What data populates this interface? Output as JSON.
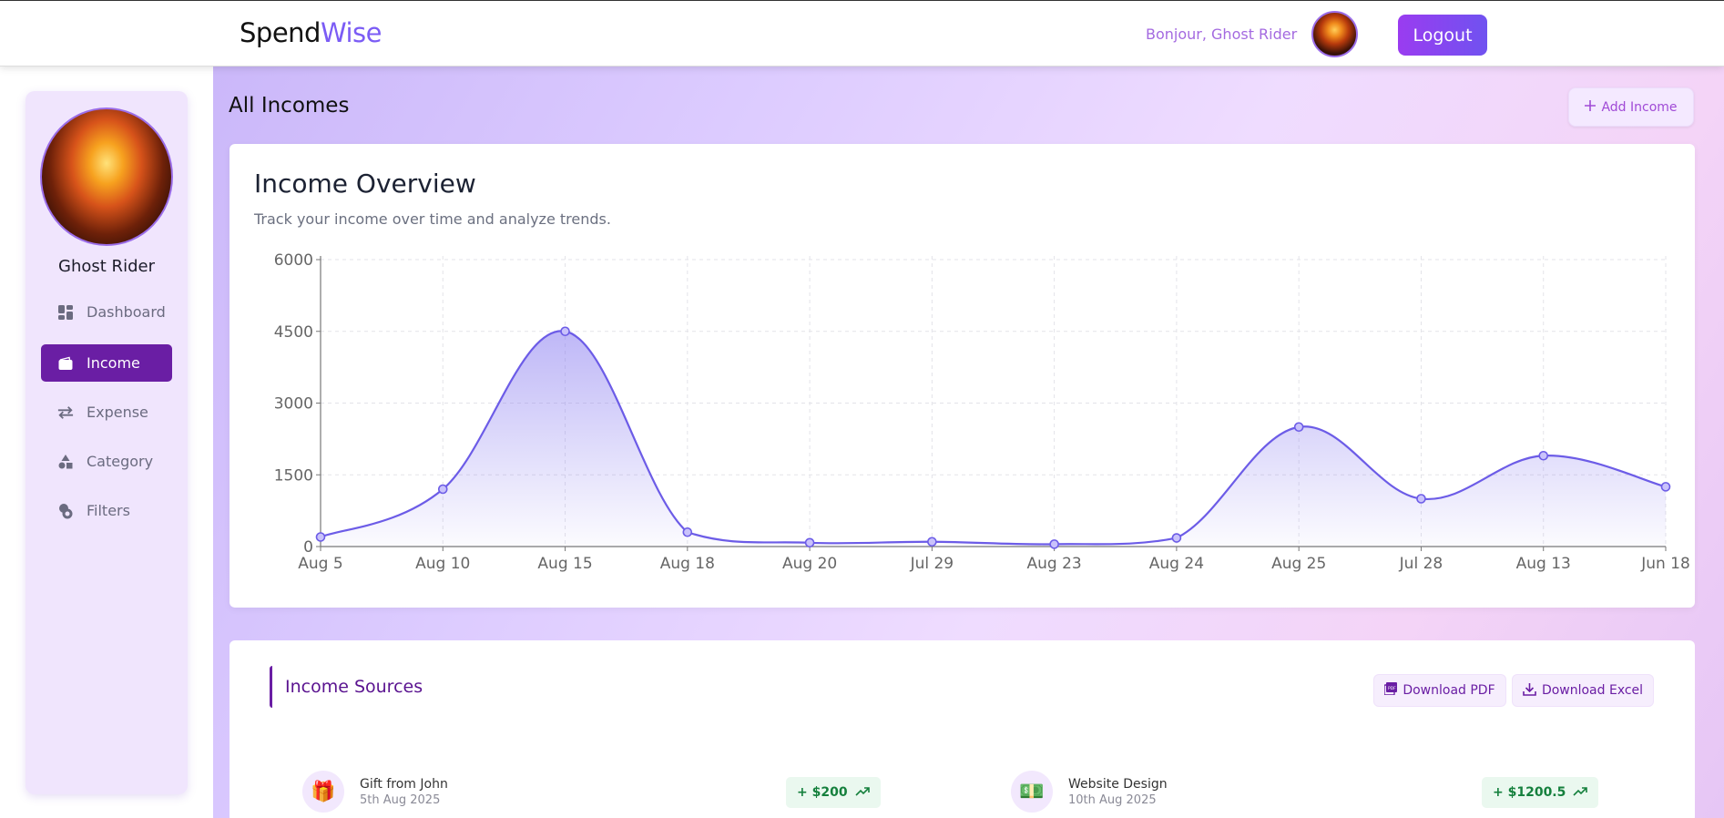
{
  "header": {
    "brand_part1": "Spend",
    "brand_part2": "Wise",
    "greeting": "Bonjour, Ghost Rider",
    "logout_label": "Logout"
  },
  "sidebar": {
    "user_name": "Ghost Rider",
    "items": [
      {
        "label": "Dashboard",
        "icon": "dashboard-icon",
        "active": false
      },
      {
        "label": "Income",
        "icon": "wallet-icon",
        "active": true
      },
      {
        "label": "Expense",
        "icon": "exchange-icon",
        "active": false
      },
      {
        "label": "Category",
        "icon": "shapes-icon",
        "active": false
      },
      {
        "label": "Filters",
        "icon": "filter-icon",
        "active": false
      }
    ]
  },
  "page": {
    "title": "All Incomes",
    "add_label": "Add Income"
  },
  "overview": {
    "title": "Income Overview",
    "subtitle": "Track your income over time and analyze trends."
  },
  "chart_data": {
    "type": "area",
    "categories": [
      "Aug 5",
      "Aug 10",
      "Aug 15",
      "Aug 18",
      "Aug 20",
      "Jul 29",
      "Aug 23",
      "Aug 24",
      "Aug 25",
      "Jul 28",
      "Aug 13",
      "Jun 18"
    ],
    "values": [
      200,
      1200,
      4500,
      300,
      80,
      100,
      50,
      180,
      2500,
      1000,
      1900,
      1250
    ],
    "yticks": [
      0,
      1500,
      3000,
      4500,
      6000
    ],
    "ylim": [
      0,
      6000
    ],
    "grid": true,
    "colors": {
      "line": "#6c5ce7",
      "fill_top": "#8a7df0",
      "grid": "#e3e3e8",
      "axis": "#777",
      "tick": "#666"
    }
  },
  "sources": {
    "title": "Income Sources",
    "download_pdf": "Download PDF",
    "download_excel": "Download Excel",
    "items": [
      {
        "name": "Gift from John",
        "date": "5th Aug 2025",
        "amount": "+ $200",
        "icon": "gift-icon",
        "emoji": "🎁"
      },
      {
        "name": "Website Design",
        "date": "10th Aug 2025",
        "amount": "+ $1200.5",
        "icon": "money-icon",
        "emoji": "💵"
      }
    ]
  }
}
